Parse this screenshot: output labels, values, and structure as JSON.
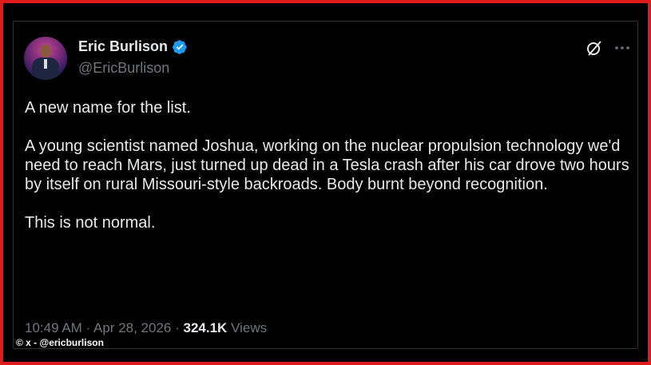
{
  "tweet": {
    "author_name": "Eric Burlison",
    "author_handle": "@EricBurlison",
    "lines": [
      "A new name for the list.",
      "A young scientist named Joshua, working on the nuclear propulsion technology we'd need to reach Mars, just turned up dead in a Tesla crash after his car drove two hours by itself on rural Missouri-style backroads. Body burnt beyond recognition.",
      "This is not normal."
    ],
    "time": "10:49 AM",
    "date": "Apr 28, 2026",
    "views_count": "324.1K",
    "views_label": "Views"
  },
  "credit": "© x - @ericburlison",
  "icons": {
    "verified": "verified-badge-icon",
    "grok": "grok-icon",
    "more": "more-options-icon"
  },
  "colors": {
    "frame": "#e01b1b",
    "verified": "#1d9bf0",
    "text": "#e7e9ea",
    "muted": "#71767b"
  }
}
